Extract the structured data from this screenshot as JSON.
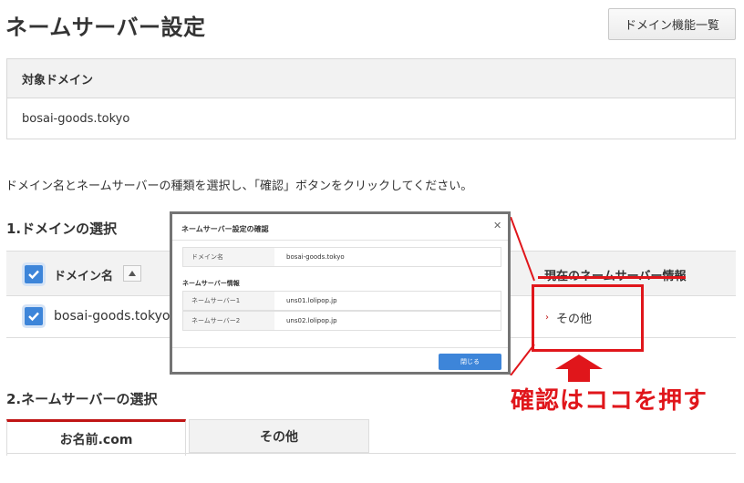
{
  "page": {
    "title": "ネームサーバー設定",
    "domain_list_button": "ドメイン機能一覧"
  },
  "target_domain": {
    "header": "対象ドメイン",
    "value": "bosai-goods.tokyo"
  },
  "instruction": "ドメイン名とネームサーバーの種類を選択し、「確認」ボタンをクリックしてください。",
  "domain_selection": {
    "heading": "1.ドメインの選択",
    "col_domain": "ドメイン名",
    "col_current_ns": "現在のネームサーバー情報",
    "rows": [
      {
        "domain": "bosai-goods.tokyo",
        "current_ns": "その他",
        "checked": true
      }
    ],
    "header_checked": true
  },
  "ns_selection": {
    "heading": "2.ネームサーバーの選択",
    "tabs": [
      "お名前.com",
      "その他"
    ],
    "active_tab": "お名前.com"
  },
  "modal": {
    "title": "ネームサーバー設定の確認",
    "domain_label": "ドメイン名",
    "domain_value": "bosai-goods.tokyo",
    "ns_section": "ネームサーバー情報",
    "ns": [
      {
        "label": "ネームサーバー1",
        "value": "uns01.lolipop.jp"
      },
      {
        "label": "ネームサーバー2",
        "value": "uns02.lolipop.jp"
      }
    ],
    "close_label": "閉じる"
  },
  "annotation": {
    "callout": "確認はココを押す",
    "color": "#e0161b"
  },
  "colors": {
    "accent_blue": "#3d85d9",
    "tab_red": "#c01515"
  }
}
